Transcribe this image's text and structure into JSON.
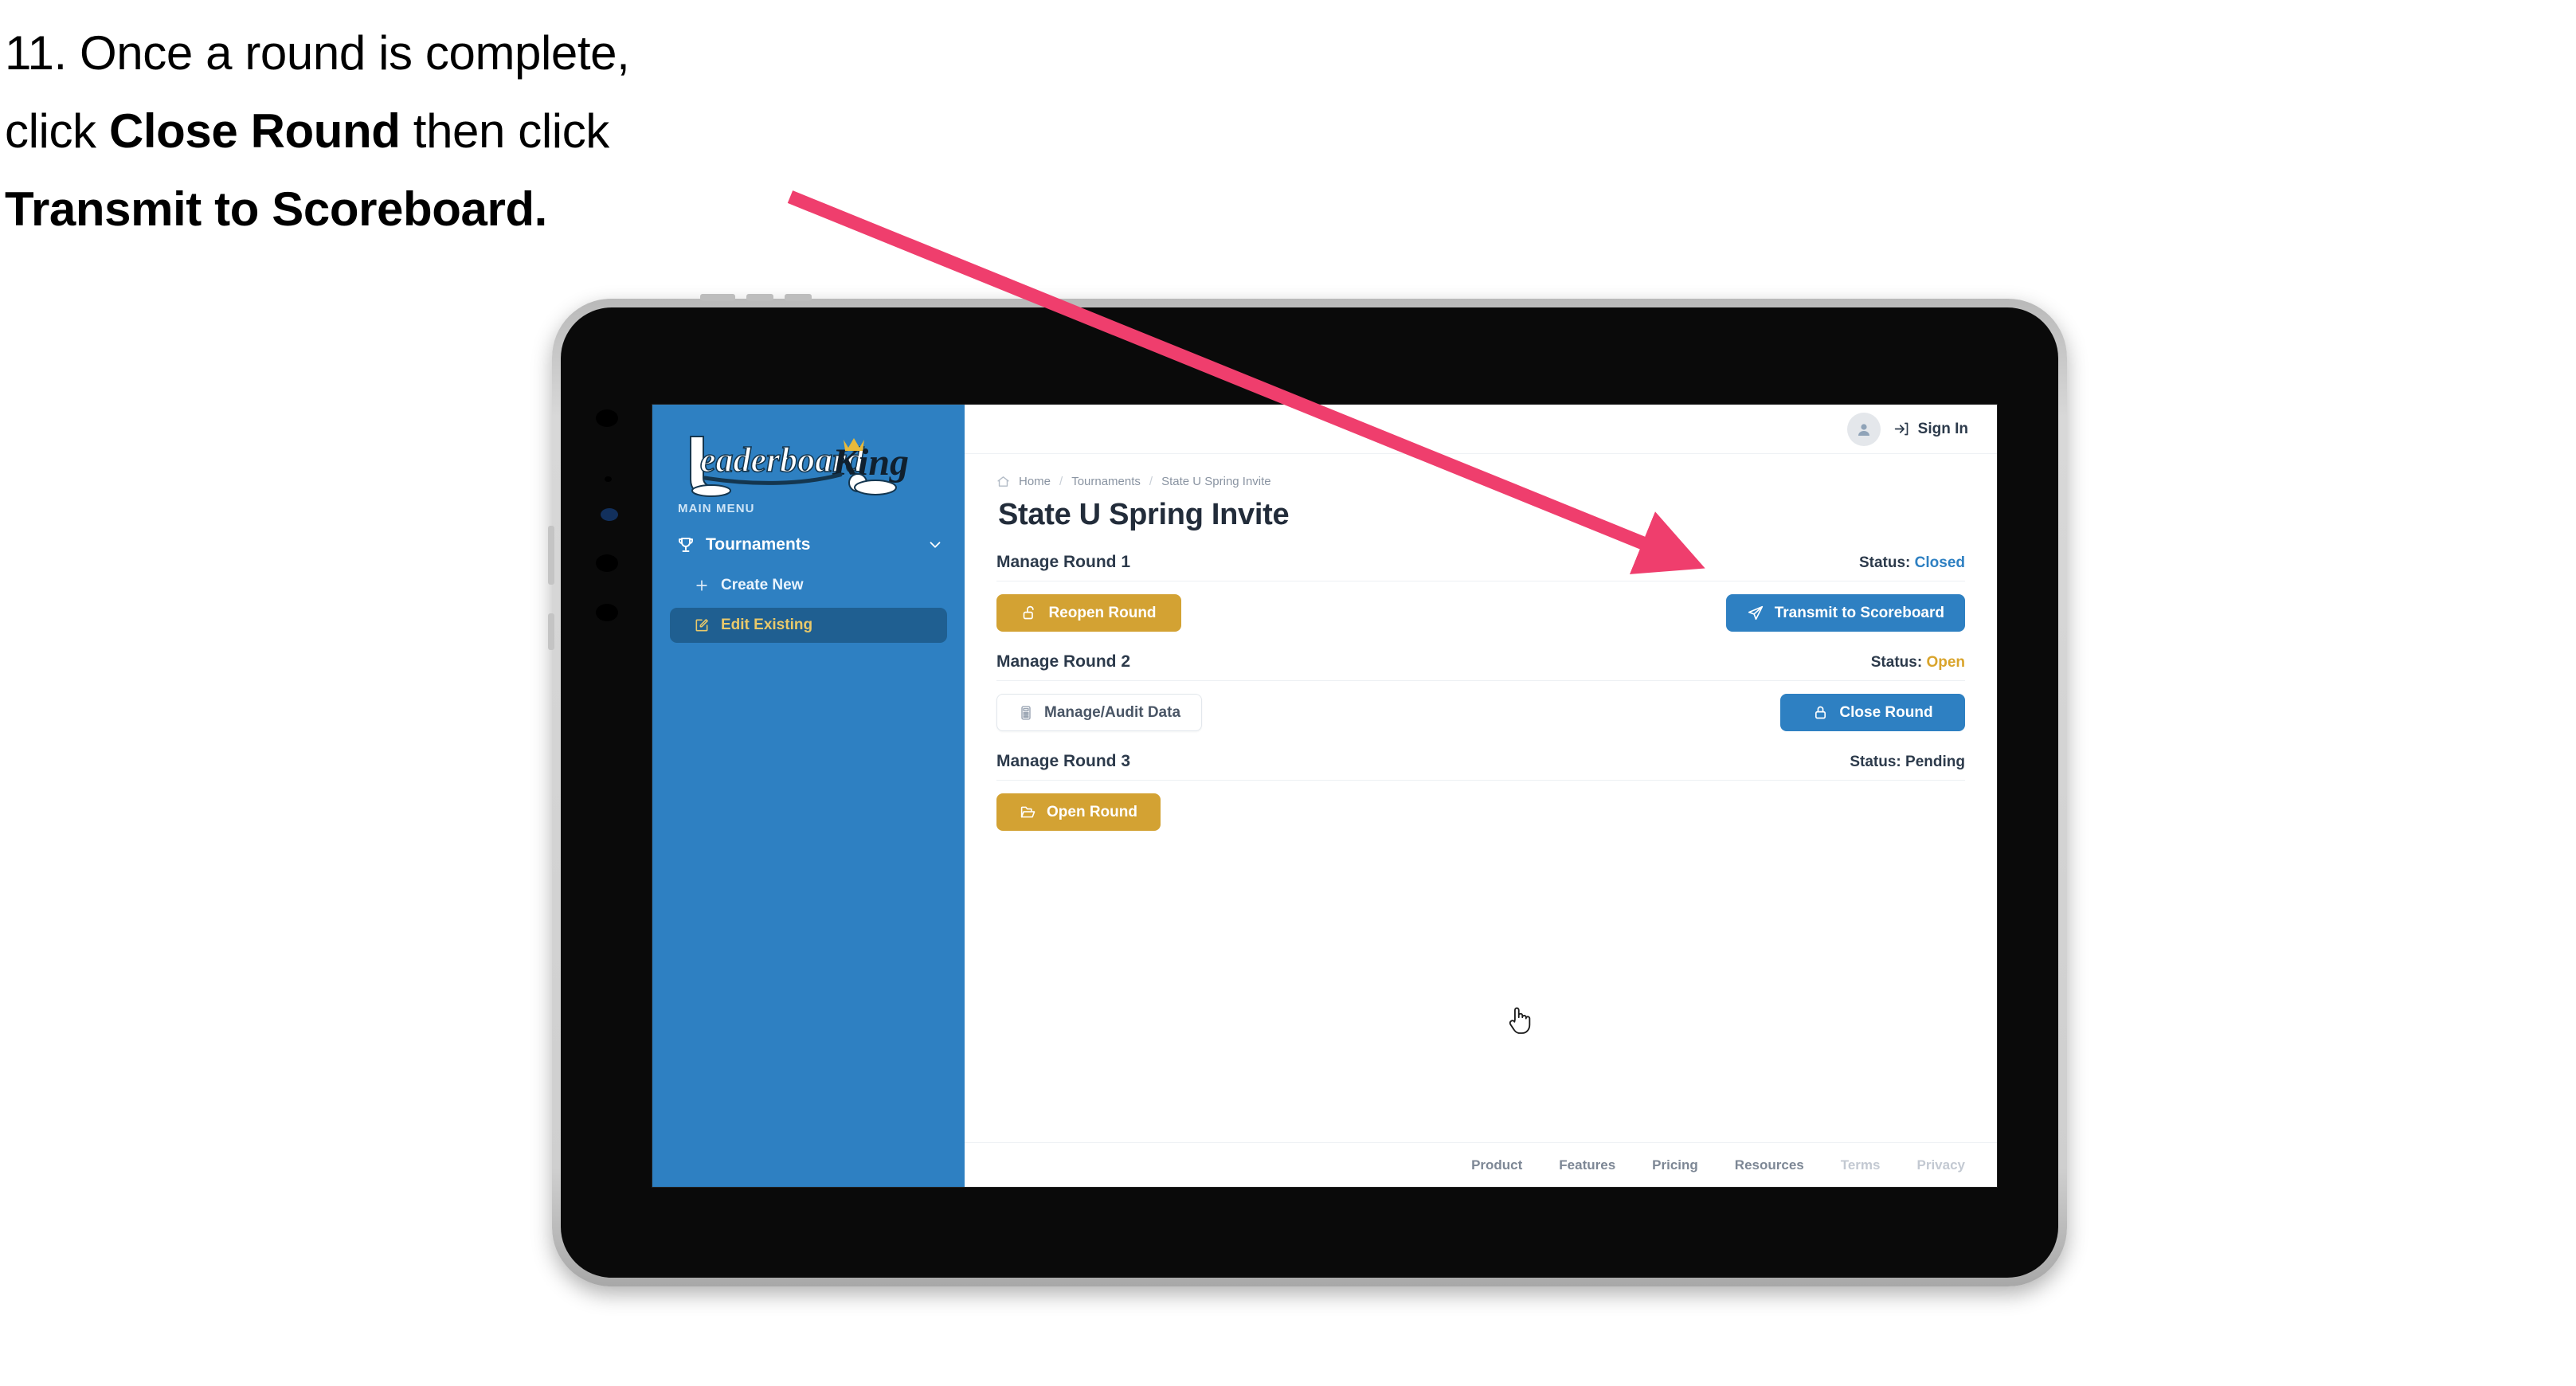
{
  "caption": {
    "line1": "11. Once a round is complete,",
    "line2_pre": "click ",
    "line2_bold": "Close Round",
    "line2_post": " then click",
    "line3_bold": "Transmit to Scoreboard."
  },
  "annotation": {
    "arrow_color": "#ef3e6d",
    "points_to": "transmit-to-scoreboard-button"
  },
  "app": {
    "sidebar": {
      "logo_text": "LeaderboardKing",
      "logo_word_one": "Leaderboard",
      "logo_word_two": "King",
      "menu_label": "MAIN MENU",
      "items": [
        {
          "label": "Tournaments",
          "icon": "trophy-icon",
          "expanded": true,
          "chevron": "chevron-down-icon"
        },
        {
          "label": "Create New",
          "icon": "plus-icon",
          "active": false
        },
        {
          "label": "Edit Existing",
          "icon": "edit-square-icon",
          "active": true
        }
      ]
    },
    "topbar": {
      "avatar_icon": "user-avatar-icon",
      "signin_label": "Sign In",
      "signin_icon": "sign-in-arrow-icon"
    },
    "breadcrumb": {
      "home_icon": "home-icon",
      "items": [
        "Home",
        "Tournaments",
        "State U Spring Invite"
      ],
      "separator": "/"
    },
    "page_title": "State U Spring Invite",
    "rounds": [
      {
        "name": "Manage Round 1",
        "status_label": "Status:",
        "status_value": "Closed",
        "status_tone": "closed",
        "left_button": {
          "label": "Reopen Round",
          "icon": "unlock-icon",
          "style": "gold"
        },
        "right_button": {
          "label": "Transmit to Scoreboard",
          "icon": "paper-plane-icon",
          "style": "blue"
        }
      },
      {
        "name": "Manage Round 2",
        "status_label": "Status:",
        "status_value": "Open",
        "status_tone": "open",
        "left_button": {
          "label": "Manage/Audit Data",
          "icon": "calculator-icon",
          "style": "ghost"
        },
        "right_button": {
          "label": "Close Round",
          "icon": "lock-icon",
          "style": "blue"
        }
      },
      {
        "name": "Manage Round 3",
        "status_label": "Status:",
        "status_value": "Pending",
        "status_tone": "pending",
        "left_button": {
          "label": "Open Round",
          "icon": "folder-open-icon",
          "style": "gold"
        },
        "right_button": null
      }
    ],
    "footer": {
      "links": [
        "Product",
        "Features",
        "Pricing",
        "Resources",
        "Terms",
        "Privacy"
      ]
    }
  },
  "colors": {
    "sidebar_blue": "#2e80c2",
    "sidebar_active": "#1f5f91",
    "gold": "#d3a233",
    "accent_gold_text": "#e9c96a",
    "arrow_pink": "#ef3e6d",
    "text_dark": "#2c3a4b"
  },
  "cursor": {
    "type": "pointing-hand-cursor"
  }
}
